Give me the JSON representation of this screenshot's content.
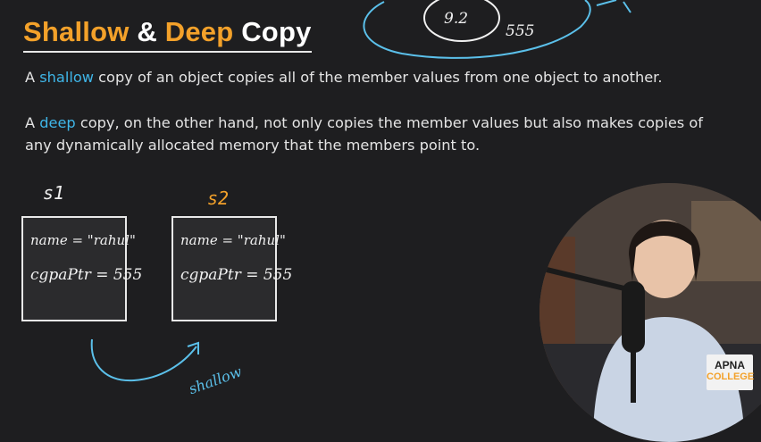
{
  "slide": {
    "title_part1": "Shallow",
    "title_part2": "&",
    "title_part3": "Deep",
    "title_part4": "Copy",
    "p1": {
      "pre": "A ",
      "highlight": "shallow",
      "post": " copy of an object copies all of the member values from one object to another."
    },
    "p2": {
      "pre": "A ",
      "highlight": "deep",
      "post": " copy, on the other hand, not only copies the member values but also makes copies of any dynamically allocated memory that the members point to."
    }
  },
  "handwriting": {
    "heap_value": "9.2",
    "heap_address": "555",
    "obj1_label": "s1",
    "obj2_label": "s2",
    "obj1_name_line": "name = \"rahul\"",
    "obj1_ptr_line": "cgpaPtr = 555",
    "obj2_name_line": "name = \"rahul\"",
    "obj2_ptr_line": "cgpaPtr = 555",
    "arrow_label": "shallow"
  },
  "branding": {
    "logo_line1": "APNA",
    "logo_line2": "COLLEGE"
  },
  "colors": {
    "accent": "#f3a12a",
    "highlight": "#3fb6e8",
    "ink_blue": "#5bc0ea",
    "background": "#1e1e20"
  }
}
